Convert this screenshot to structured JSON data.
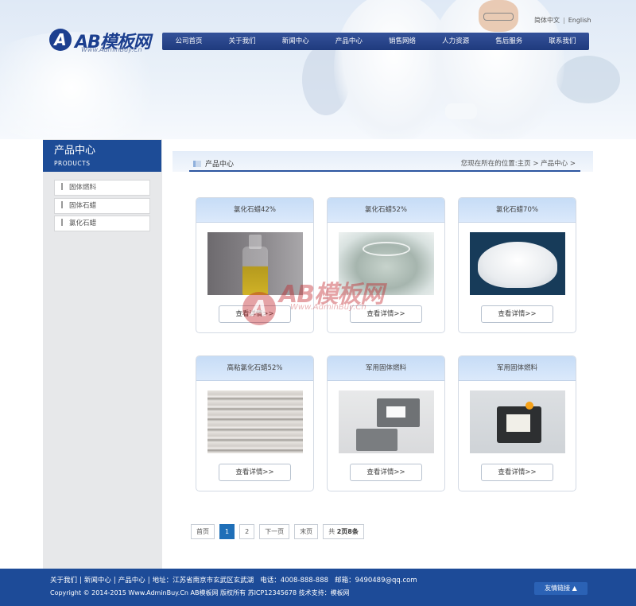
{
  "logo": {
    "mark": "A",
    "name": "AB模板网",
    "sub": "Www.AdminBuy.Cn"
  },
  "lang": {
    "cn": "简体中文",
    "en": "English"
  },
  "nav": [
    "公司首页",
    "关于我们",
    "新闻中心",
    "产品中心",
    "销售网络",
    "人力资源",
    "售后服务",
    "联系我们"
  ],
  "sidebar": {
    "title": "产品中心",
    "subtitle": "PRODUCTS",
    "items": [
      "固体燃料",
      "固体石蜡",
      "氯化石蜡"
    ]
  },
  "crumb": {
    "title": "产品中心",
    "prefix": "您现在所在的位置:",
    "home": "主页",
    "sep": ">",
    "current": "产品中心",
    "tail": ">"
  },
  "products": [
    {
      "name": "氯化石蜡42%",
      "button": "查看详情>>",
      "image": "oil-bottle"
    },
    {
      "name": "氯化石蜡52%",
      "button": "查看详情>>",
      "image": "glass-jar"
    },
    {
      "name": "氯化石蜡70%",
      "button": "查看详情>>",
      "image": "white-powder"
    },
    {
      "name": "高粘氯化石蜡52%",
      "button": "查看详情>>",
      "image": "rope-material"
    },
    {
      "name": "军用固体燃料",
      "button": "查看详情>>",
      "image": "metal-part"
    },
    {
      "name": "军用固体燃料",
      "button": "查看详情>>",
      "image": "device"
    }
  ],
  "watermark": {
    "mark": "A",
    "name": "AB模板网",
    "sub": "Www.AdminBuy.Cn"
  },
  "pager": {
    "first": "首页",
    "pages": [
      "1",
      "2"
    ],
    "current": "1",
    "next": "下一页",
    "last": "末页",
    "total_prefix": "共",
    "total_bold": "2页8条"
  },
  "footer": {
    "links": [
      "关于我们",
      "新闻中心",
      "产品中心"
    ],
    "address": "地址：江苏省南京市玄武区玄武湖",
    "phone": "电话：4008-888-888",
    "email": "邮箱：9490489@qq.com",
    "copyright": "Copyright © 2014-2015 Www.AdminBuy.Cn AB模板网 版权所有  苏ICP12345678 技术支持：模板网",
    "friend_links": "友情链接 ▲"
  },
  "colors": {
    "brand": "#1d4b98",
    "nav": "#1f3a7d",
    "active_page": "#1f6fb8"
  }
}
